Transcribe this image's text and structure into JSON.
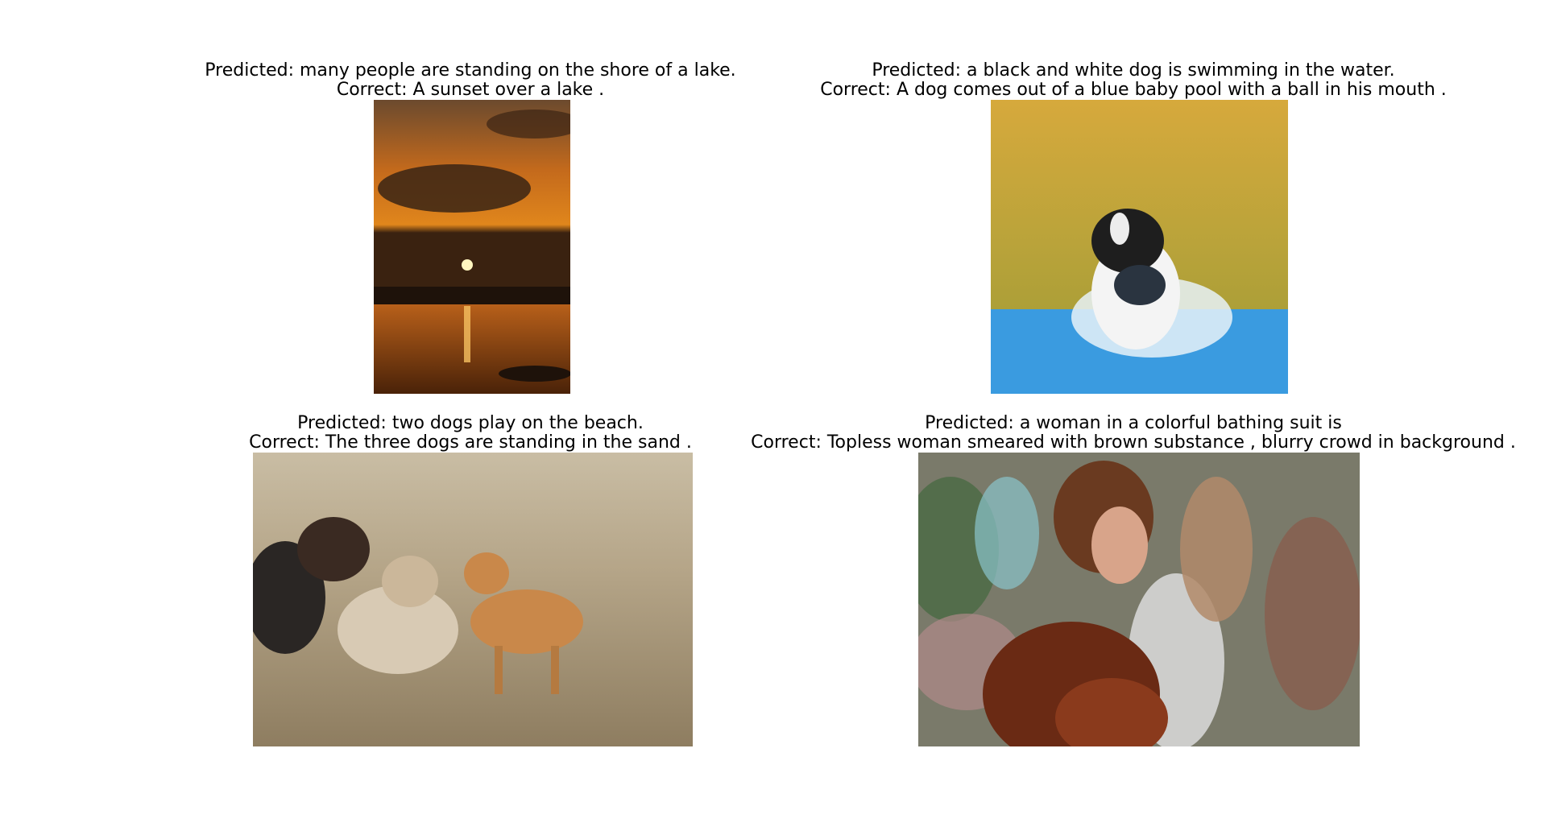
{
  "panels": [
    {
      "predicted": "Predicted: many people are standing on the shore of a lake.",
      "correct": "Correct: A sunset over a lake .",
      "image": "sunset-over-lake-photo"
    },
    {
      "predicted": "Predicted: a black and white dog is swimming in the water.",
      "correct": "Correct: A dog comes out of a blue baby pool with a ball in his mouth .",
      "image": "dog-in-baby-pool-photo"
    },
    {
      "predicted": "Predicted: two dogs play on the beach.",
      "correct": "Correct: The three dogs are standing in the sand .",
      "image": "dogs-on-sand-photo"
    },
    {
      "predicted": "Predicted: a woman in a colorful bathing suit is",
      "correct": "Correct: Topless woman smeared with brown substance , blurry crowd in background .",
      "image": "woman-with-brown-substance-photo"
    }
  ],
  "colors": {
    "sunset_sky": "#c46a1c",
    "grass": "#d1a83a",
    "pool_blue": "#3a9be0",
    "sand": "#a8977a"
  }
}
